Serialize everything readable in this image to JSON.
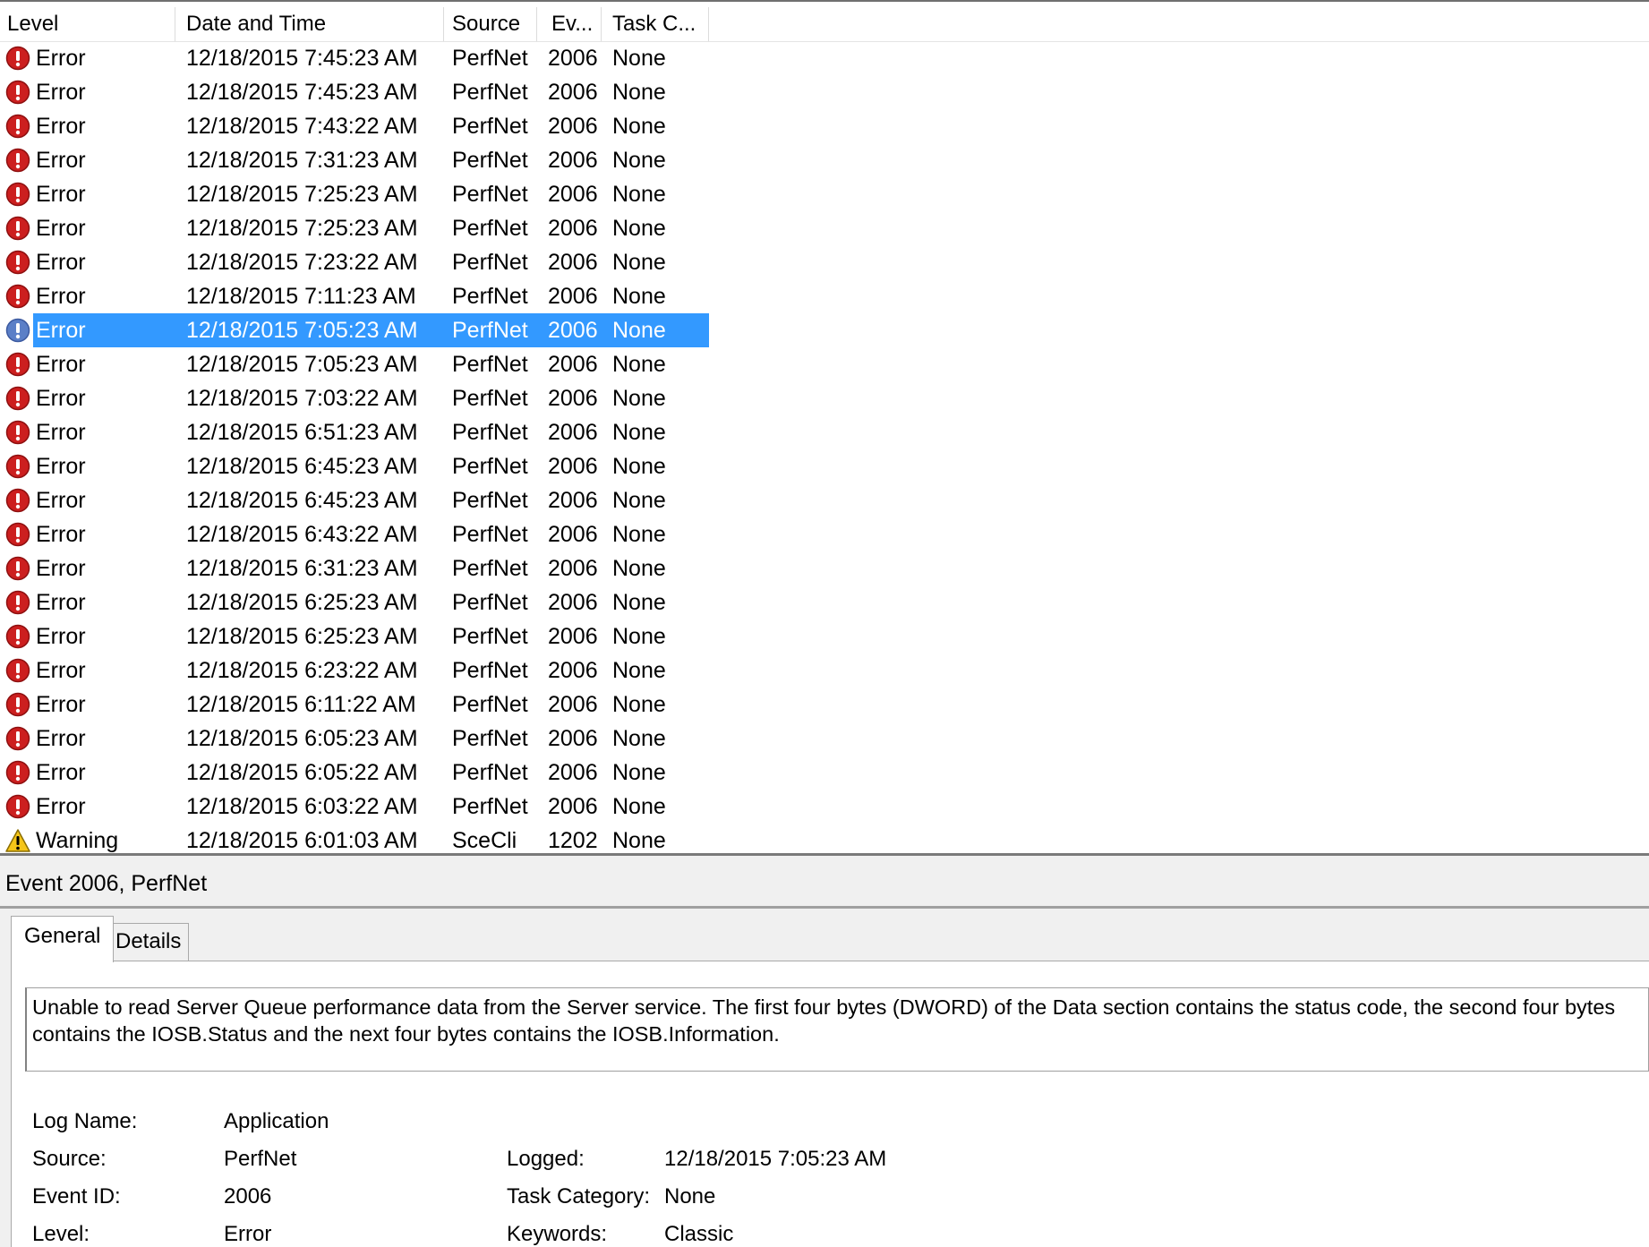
{
  "columns": {
    "level": "Level",
    "date_time": "Date and Time",
    "source": "Source",
    "event_id": "Ev...",
    "task_category": "Task C..."
  },
  "events": [
    {
      "level": "Error",
      "date_time": "12/18/2015 7:45:23 AM",
      "source": "PerfNet",
      "event_id": "2006",
      "task": "None",
      "icon": "error-icon"
    },
    {
      "level": "Error",
      "date_time": "12/18/2015 7:45:23 AM",
      "source": "PerfNet",
      "event_id": "2006",
      "task": "None",
      "icon": "error-icon"
    },
    {
      "level": "Error",
      "date_time": "12/18/2015 7:43:22 AM",
      "source": "PerfNet",
      "event_id": "2006",
      "task": "None",
      "icon": "error-icon"
    },
    {
      "level": "Error",
      "date_time": "12/18/2015 7:31:23 AM",
      "source": "PerfNet",
      "event_id": "2006",
      "task": "None",
      "icon": "error-icon"
    },
    {
      "level": "Error",
      "date_time": "12/18/2015 7:25:23 AM",
      "source": "PerfNet",
      "event_id": "2006",
      "task": "None",
      "icon": "error-icon"
    },
    {
      "level": "Error",
      "date_time": "12/18/2015 7:25:23 AM",
      "source": "PerfNet",
      "event_id": "2006",
      "task": "None",
      "icon": "error-icon"
    },
    {
      "level": "Error",
      "date_time": "12/18/2015 7:23:22 AM",
      "source": "PerfNet",
      "event_id": "2006",
      "task": "None",
      "icon": "error-icon"
    },
    {
      "level": "Error",
      "date_time": "12/18/2015 7:11:23 AM",
      "source": "PerfNet",
      "event_id": "2006",
      "task": "None",
      "icon": "error-icon"
    },
    {
      "level": "Error",
      "date_time": "12/18/2015 7:05:23 AM",
      "source": "PerfNet",
      "event_id": "2006",
      "task": "None",
      "icon": "error-icon",
      "selected": true
    },
    {
      "level": "Error",
      "date_time": "12/18/2015 7:05:23 AM",
      "source": "PerfNet",
      "event_id": "2006",
      "task": "None",
      "icon": "error-icon"
    },
    {
      "level": "Error",
      "date_time": "12/18/2015 7:03:22 AM",
      "source": "PerfNet",
      "event_id": "2006",
      "task": "None",
      "icon": "error-icon"
    },
    {
      "level": "Error",
      "date_time": "12/18/2015 6:51:23 AM",
      "source": "PerfNet",
      "event_id": "2006",
      "task": "None",
      "icon": "error-icon"
    },
    {
      "level": "Error",
      "date_time": "12/18/2015 6:45:23 AM",
      "source": "PerfNet",
      "event_id": "2006",
      "task": "None",
      "icon": "error-icon"
    },
    {
      "level": "Error",
      "date_time": "12/18/2015 6:45:23 AM",
      "source": "PerfNet",
      "event_id": "2006",
      "task": "None",
      "icon": "error-icon"
    },
    {
      "level": "Error",
      "date_time": "12/18/2015 6:43:22 AM",
      "source": "PerfNet",
      "event_id": "2006",
      "task": "None",
      "icon": "error-icon"
    },
    {
      "level": "Error",
      "date_time": "12/18/2015 6:31:23 AM",
      "source": "PerfNet",
      "event_id": "2006",
      "task": "None",
      "icon": "error-icon"
    },
    {
      "level": "Error",
      "date_time": "12/18/2015 6:25:23 AM",
      "source": "PerfNet",
      "event_id": "2006",
      "task": "None",
      "icon": "error-icon"
    },
    {
      "level": "Error",
      "date_time": "12/18/2015 6:25:23 AM",
      "source": "PerfNet",
      "event_id": "2006",
      "task": "None",
      "icon": "error-icon"
    },
    {
      "level": "Error",
      "date_time": "12/18/2015 6:23:22 AM",
      "source": "PerfNet",
      "event_id": "2006",
      "task": "None",
      "icon": "error-icon"
    },
    {
      "level": "Error",
      "date_time": "12/18/2015 6:11:22 AM",
      "source": "PerfNet",
      "event_id": "2006",
      "task": "None",
      "icon": "error-icon"
    },
    {
      "level": "Error",
      "date_time": "12/18/2015 6:05:23 AM",
      "source": "PerfNet",
      "event_id": "2006",
      "task": "None",
      "icon": "error-icon"
    },
    {
      "level": "Error",
      "date_time": "12/18/2015 6:05:22 AM",
      "source": "PerfNet",
      "event_id": "2006",
      "task": "None",
      "icon": "error-icon"
    },
    {
      "level": "Error",
      "date_time": "12/18/2015 6:03:22 AM",
      "source": "PerfNet",
      "event_id": "2006",
      "task": "None",
      "icon": "error-icon"
    },
    {
      "level": "Warning",
      "date_time": "12/18/2015 6:01:03 AM",
      "source": "SceCli",
      "event_id": "1202",
      "task": "None",
      "icon": "warning-icon"
    }
  ],
  "colors": {
    "selection": "#3399ff",
    "error_red": "#cc1f1f",
    "warning_yellow": "#f5c518",
    "pane_bg": "#f0f0f0"
  },
  "detail": {
    "title": "Event 2006, PerfNet",
    "tabs": [
      "General",
      "Details"
    ],
    "active_tab": "General",
    "description": "Unable to read Server Queue performance data from the Server service. The first four bytes (DWORD) of the Data section contains the status code, the second four bytes contains the IOSB.Status and the next four bytes contains the IOSB.Information.",
    "fields": {
      "log_name_label": "Log Name:",
      "log_name": "Application",
      "source_label": "Source:",
      "source": "PerfNet",
      "logged_label": "Logged:",
      "logged": "12/18/2015 7:05:23 AM",
      "event_id_label": "Event ID:",
      "event_id": "2006",
      "task_category_label": "Task Category:",
      "task_category": "None",
      "level_label": "Level:",
      "level": "Error",
      "keywords_label": "Keywords:",
      "keywords": "Classic"
    }
  }
}
